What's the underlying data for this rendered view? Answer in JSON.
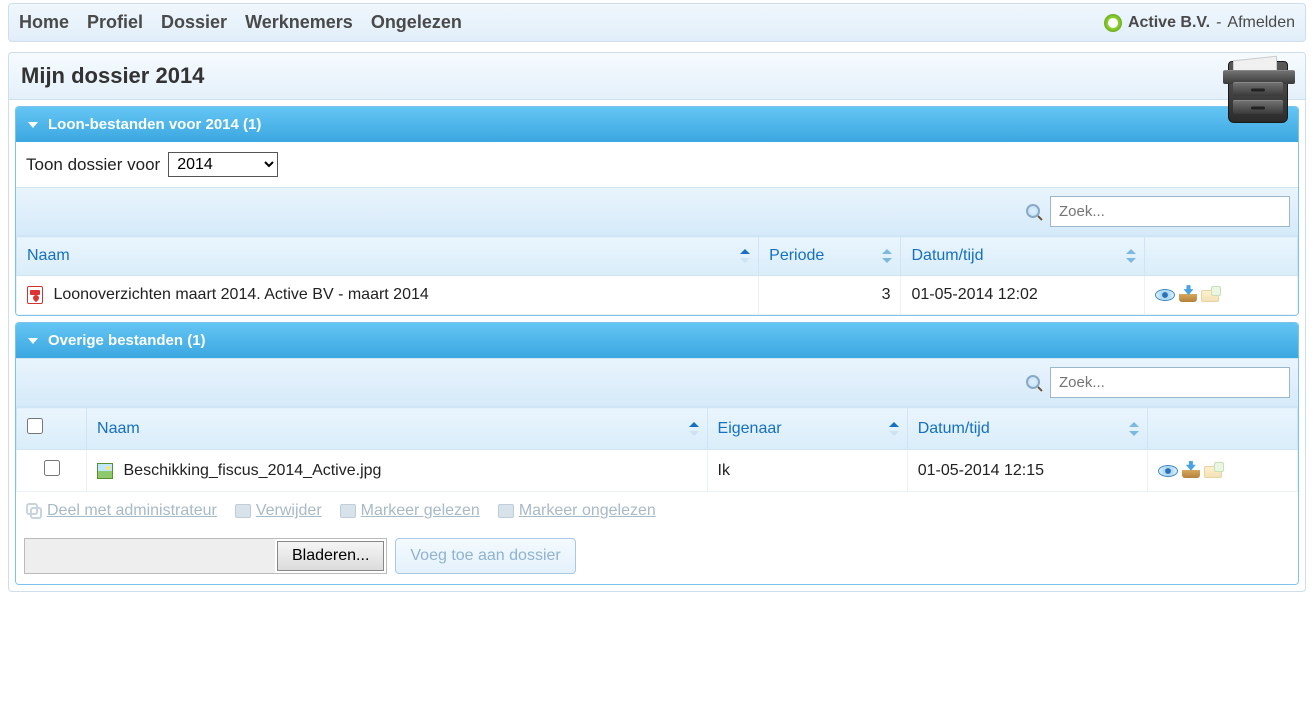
{
  "nav": {
    "items": [
      "Home",
      "Profiel",
      "Dossier",
      "Werknemers",
      "Ongelezen"
    ],
    "company": "Active B.V.",
    "logout": "Afmelden"
  },
  "page": {
    "title": "Mijn dossier 2014"
  },
  "section1": {
    "title": "Loon-bestanden voor 2014 (1)",
    "filter_label": "Toon dossier voor",
    "filter_value": "2014",
    "search_placeholder": "Zoek...",
    "headers": {
      "name": "Naam",
      "period": "Periode",
      "date": "Datum/tijd"
    },
    "rows": [
      {
        "name": "Loonoverzichten maart 2014. Active BV - maart 2014",
        "period": "3",
        "date": "01-05-2014 12:02"
      }
    ]
  },
  "section2": {
    "title": "Overige bestanden (1)",
    "search_placeholder": "Zoek...",
    "headers": {
      "name": "Naam",
      "owner": "Eigenaar",
      "date": "Datum/tijd"
    },
    "rows": [
      {
        "name": "Beschikking_fiscus_2014_Active.jpg",
        "owner": "Ik",
        "date": "01-05-2014 12:15"
      }
    ],
    "actions": {
      "share": "Deel met administrateur",
      "delete": "Verwijder",
      "mark_read": "Markeer gelezen",
      "mark_unread": "Markeer ongelezen"
    },
    "browse": "Bladeren...",
    "add": "Voeg toe aan dossier"
  }
}
